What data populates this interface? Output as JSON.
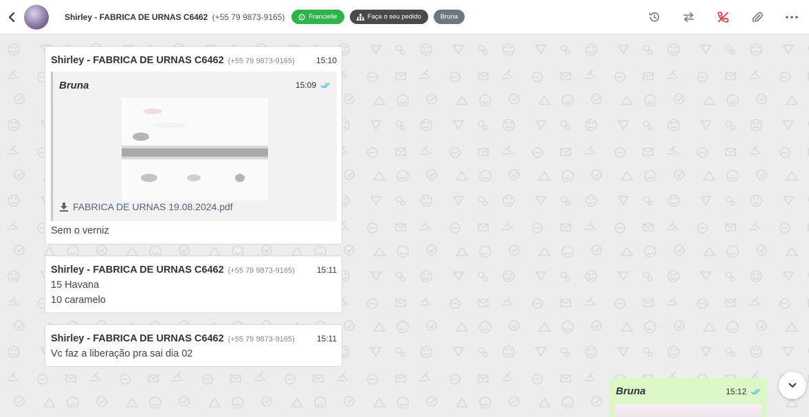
{
  "header": {
    "contact_name": "Shirley - FABRICA DE URNAS C6462",
    "contact_phone": "(+55 79 9873-9165)",
    "tags": [
      {
        "label": "Francielle",
        "icon": "whatsapp-icon",
        "color": "#2db44a"
      },
      {
        "label": "Faça o seu pedido",
        "icon": "sitemap-icon",
        "color": "#4a4a4a"
      },
      {
        "label": "Bruna",
        "icon": "",
        "color": "#6e7780"
      }
    ],
    "actions": [
      "history-icon",
      "transfer-icon",
      "end-call-icon",
      "attach-icon",
      "more-icon"
    ]
  },
  "messages": [
    {
      "sender": "Shirley - FABRICA DE URNAS C6462",
      "phone": "(+55 79 9873-9165)",
      "time": "15:10",
      "quote": {
        "author": "Bruna",
        "time": "15:09",
        "file_name": "FABRICA DE URNAS 19.08.2024.pdf"
      },
      "lines": [
        "Sem o verniz"
      ]
    },
    {
      "sender": "Shirley - FABRICA DE URNAS C6462",
      "phone": "(+55 79 9873-9165)",
      "time": "15:11",
      "lines": [
        "15 Havana",
        "10 caramelo"
      ]
    },
    {
      "sender": "Shirley - FABRICA DE URNAS C6462",
      "phone": "(+55 79 9873-9165)",
      "time": "15:11",
      "lines": [
        "Vc faz a liberação pra sai dia 02"
      ]
    }
  ],
  "outgoing": {
    "author": "Bruna",
    "time": "15:12"
  },
  "colors": {
    "accent_green": "#2db44a",
    "outgoing_bubble": "#dcf8c6",
    "read_tick": "#4fb8e6",
    "end_call": "#d9313b"
  }
}
